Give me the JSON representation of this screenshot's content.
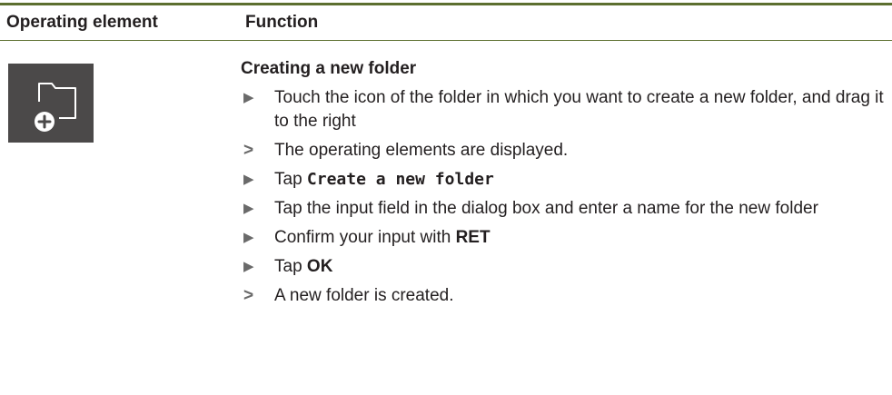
{
  "table": {
    "header": {
      "col1": "Operating element",
      "col2": "Function"
    },
    "row": {
      "icon": "new-folder-icon",
      "title": "Creating a new folder",
      "steps": [
        {
          "type": "action",
          "text": "Touch the icon of the folder in which you want to create a new folder, and drag it to the right"
        },
        {
          "type": "result",
          "text": "The operating elements are displayed."
        },
        {
          "type": "action",
          "prefix": "Tap ",
          "bold": "Create a new folder"
        },
        {
          "type": "action",
          "text": "Tap the input field in the dialog box and enter a name for the new folder"
        },
        {
          "type": "action",
          "prefix": "Confirm your input with ",
          "bold": "RET"
        },
        {
          "type": "action",
          "prefix": "Tap ",
          "bold": "OK"
        },
        {
          "type": "result",
          "text": "A new folder is created."
        }
      ]
    }
  },
  "colors": {
    "rule": "#5c6f2f",
    "icon_bg": "#4b4949",
    "marker": "#6a6a6a"
  }
}
